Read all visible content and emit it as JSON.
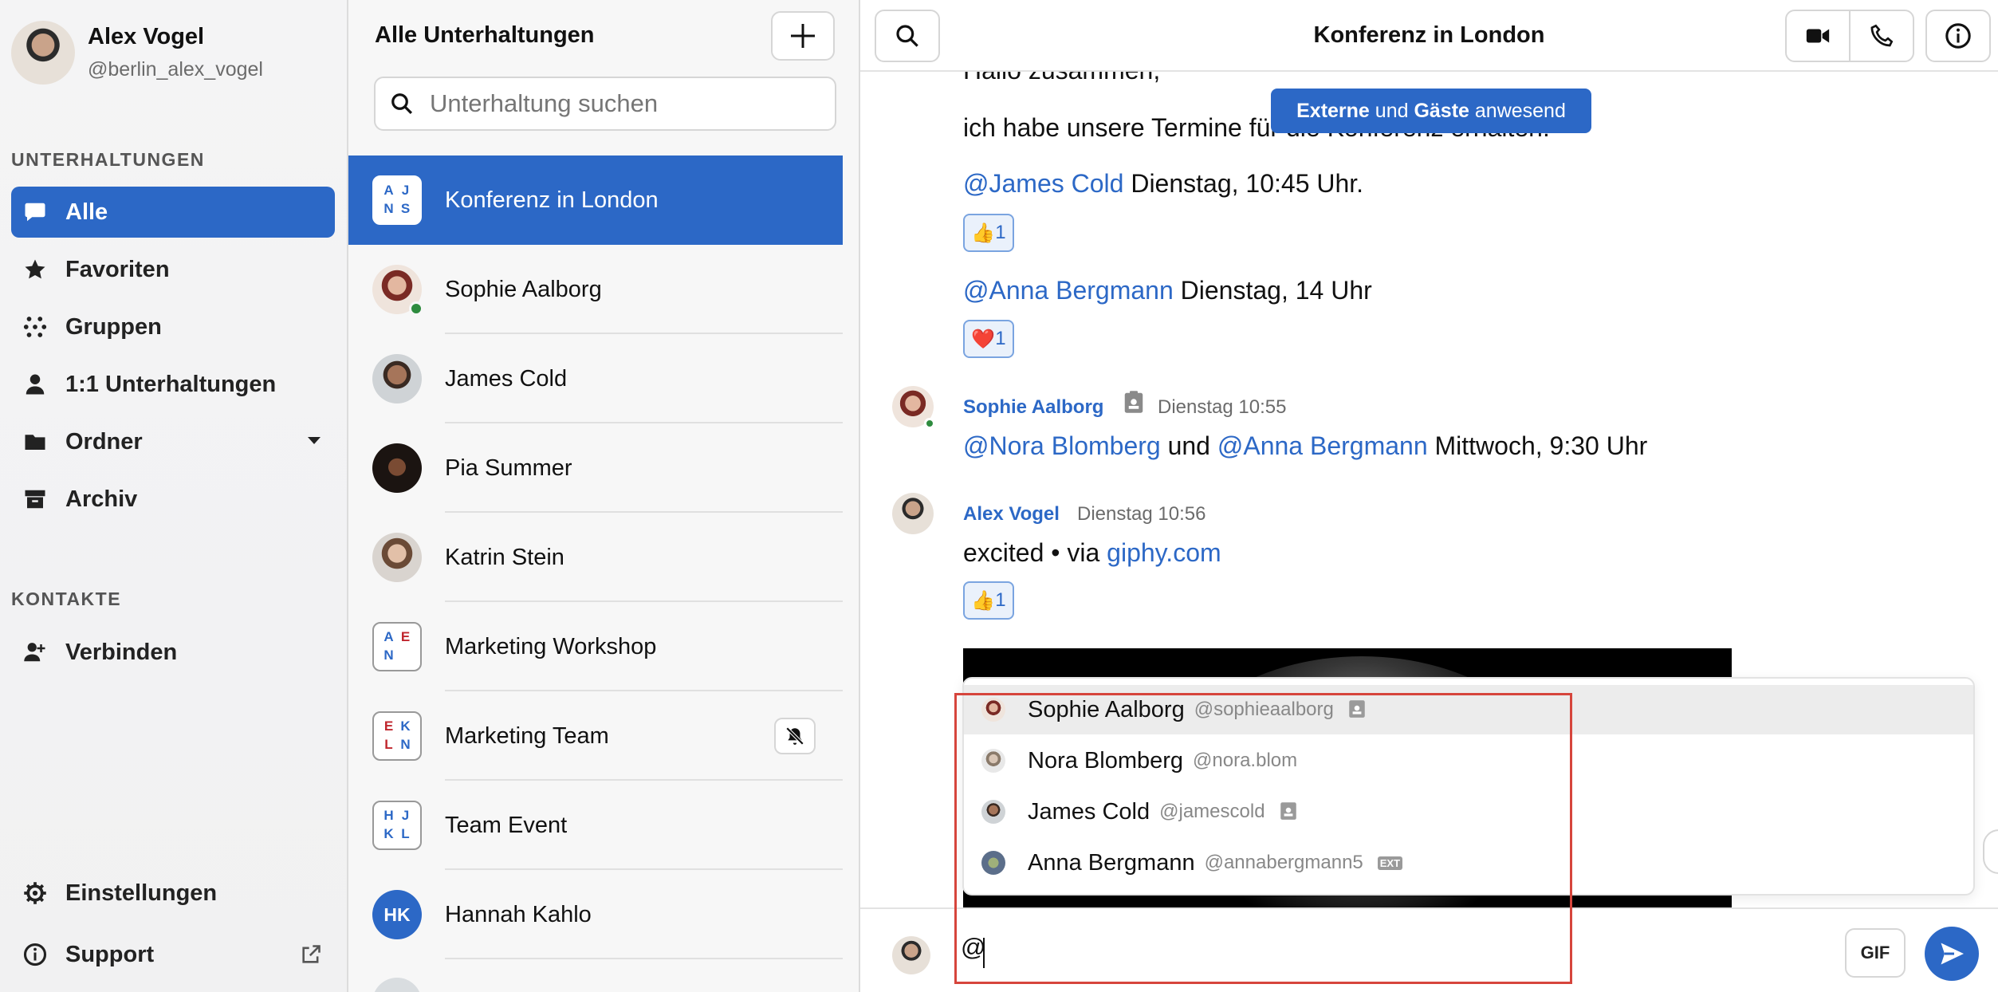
{
  "profile": {
    "name": "Alex Vogel",
    "handle": "@berlin_alex_vogel"
  },
  "sidebar": {
    "section_conversations": "UNTERHALTUNGEN",
    "items": [
      {
        "label": "Alle",
        "icon": "chat-bubble-icon",
        "active": true
      },
      {
        "label": "Favoriten",
        "icon": "star-icon"
      },
      {
        "label": "Gruppen",
        "icon": "groups-dots-icon"
      },
      {
        "label": "1:1 Unterhaltungen",
        "icon": "person-icon"
      },
      {
        "label": "Ordner",
        "icon": "folder-icon"
      },
      {
        "label": "Archiv",
        "icon": "archive-icon"
      }
    ],
    "section_contacts": "KONTAKTE",
    "connect_label": "Verbinden",
    "settings_label": "Einstellungen",
    "support_label": "Support"
  },
  "conversations": {
    "title": "Alle Unterhaltungen",
    "search_placeholder": "Unterhaltung suchen",
    "items": [
      {
        "name": "Konferenz in London",
        "type": "group",
        "letters": [
          "A",
          "J",
          "N",
          "S"
        ],
        "active": true
      },
      {
        "name": "Sophie Aalborg",
        "type": "person",
        "online": true
      },
      {
        "name": "James Cold",
        "type": "person"
      },
      {
        "name": "Pia Summer",
        "type": "person"
      },
      {
        "name": "Katrin Stein",
        "type": "person"
      },
      {
        "name": "Marketing Workshop",
        "type": "group",
        "letters": [
          "A",
          "E",
          "N",
          ""
        ]
      },
      {
        "name": "Marketing Team",
        "type": "group",
        "letters": [
          "E",
          "K",
          "L",
          "N"
        ],
        "muted": true
      },
      {
        "name": "Team Event",
        "type": "group",
        "letters": [
          "H",
          "J",
          "K",
          "L"
        ]
      },
      {
        "name": "Hannah Kahlo",
        "type": "initials",
        "initials": "HK"
      }
    ]
  },
  "chat": {
    "title": "Konferenz in London",
    "banner": {
      "strong1": "Externe",
      "mid": " und ",
      "strong2": "Gäste",
      "tail": " anwesend"
    },
    "partial_top": "Hallo zusammen,",
    "line_intro": "ich habe unsere Termine für die Konferenz erhalten:",
    "line1": {
      "mention": "@James Cold",
      "text": " Dienstag, 10:45 Uhr."
    },
    "reaction1": {
      "emoji": "👍",
      "count": "1"
    },
    "line2": {
      "mention": "@Anna Bergmann",
      "text": " Dienstag, 14 Uhr"
    },
    "reaction2": {
      "emoji": "❤️",
      "count": "1"
    },
    "msg_sophie": {
      "sender": "Sophie Aalborg",
      "time": "Dienstag 10:55",
      "mention1": "@Nora Blomberg",
      "mid": " und ",
      "mention2": "@Anna Bergmann",
      "tail": " Mittwoch, 9:30 Uhr"
    },
    "msg_alex": {
      "sender": "Alex Vogel",
      "time": "Dienstag 10:56",
      "text": "excited • via ",
      "link": "giphy.com"
    },
    "reaction3": {
      "emoji": "👍",
      "count": "1"
    },
    "mention_suggestions": [
      {
        "name": "Sophie Aalborg",
        "handle": "@sophieaalborg",
        "badge": "guest-badge-icon",
        "highlighted": true
      },
      {
        "name": "Nora Blomberg",
        "handle": "@nora.blom",
        "badge": ""
      },
      {
        "name": "James Cold",
        "handle": "@jamescold",
        "badge": "guest-badge-icon"
      },
      {
        "name": "Anna Bergmann",
        "handle": "@annabergmann5",
        "badge": "EXT"
      }
    ],
    "composer_value": "@",
    "gif_label": "GIF"
  },
  "colors": {
    "accent": "#2c68c6",
    "highlight_box": "#d6453c",
    "online": "#2e8b3e"
  }
}
